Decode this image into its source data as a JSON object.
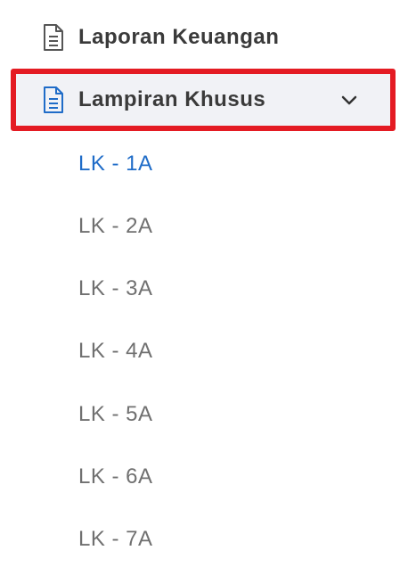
{
  "menu": {
    "laporan": {
      "label": "Laporan Keuangan",
      "icon": "document-icon"
    },
    "lampiran": {
      "label": "Lampiran Khusus",
      "icon": "document-icon",
      "expanded": true
    },
    "subitems": [
      {
        "label": "LK - 1A",
        "active": true
      },
      {
        "label": "LK - 2A",
        "active": false
      },
      {
        "label": "LK - 3A",
        "active": false
      },
      {
        "label": "LK - 4A",
        "active": false
      },
      {
        "label": "LK - 5A",
        "active": false
      },
      {
        "label": "LK - 6A",
        "active": false
      },
      {
        "label": "LK - 7A",
        "active": false
      }
    ]
  },
  "colors": {
    "highlight_border": "#e41b23",
    "active_text": "#1f6cc8",
    "inactive_text": "#707070",
    "selected_bg": "#f1f2f6"
  }
}
